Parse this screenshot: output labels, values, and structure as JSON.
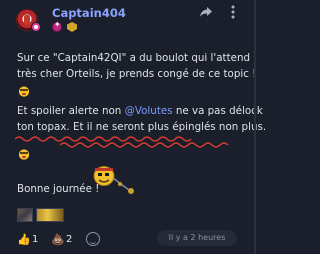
{
  "post": {
    "author": "Captain404",
    "lines": [
      "Sur ce \"Captain42QI\" a du boulot qui l'attend",
      "très cher Orteils, je prends congé de ce topic !"
    ],
    "spoiler_prefix": "Et spoiler alerte non ",
    "mention": "@Volutes",
    "spoiler_suffix": " ne va pas délock",
    "underline_line": "ton topax. Et il ne seront plus épinglés non plus.",
    "closing": "Bonne journée !",
    "timestamp": "Il y a 2 heures"
  },
  "reactions": [
    {
      "icon": "thumbs-up-icon",
      "count": "1"
    },
    {
      "icon": "poop-icon",
      "count": "2"
    }
  ],
  "icons": {
    "share": "share-icon",
    "more": "more-vertical-icon",
    "add_reaction": "add-reaction-icon"
  },
  "colors": {
    "background": "#1a1f2b",
    "username": "#8aa3ff",
    "mention": "#7d9cff",
    "underline": "#d43a32"
  }
}
